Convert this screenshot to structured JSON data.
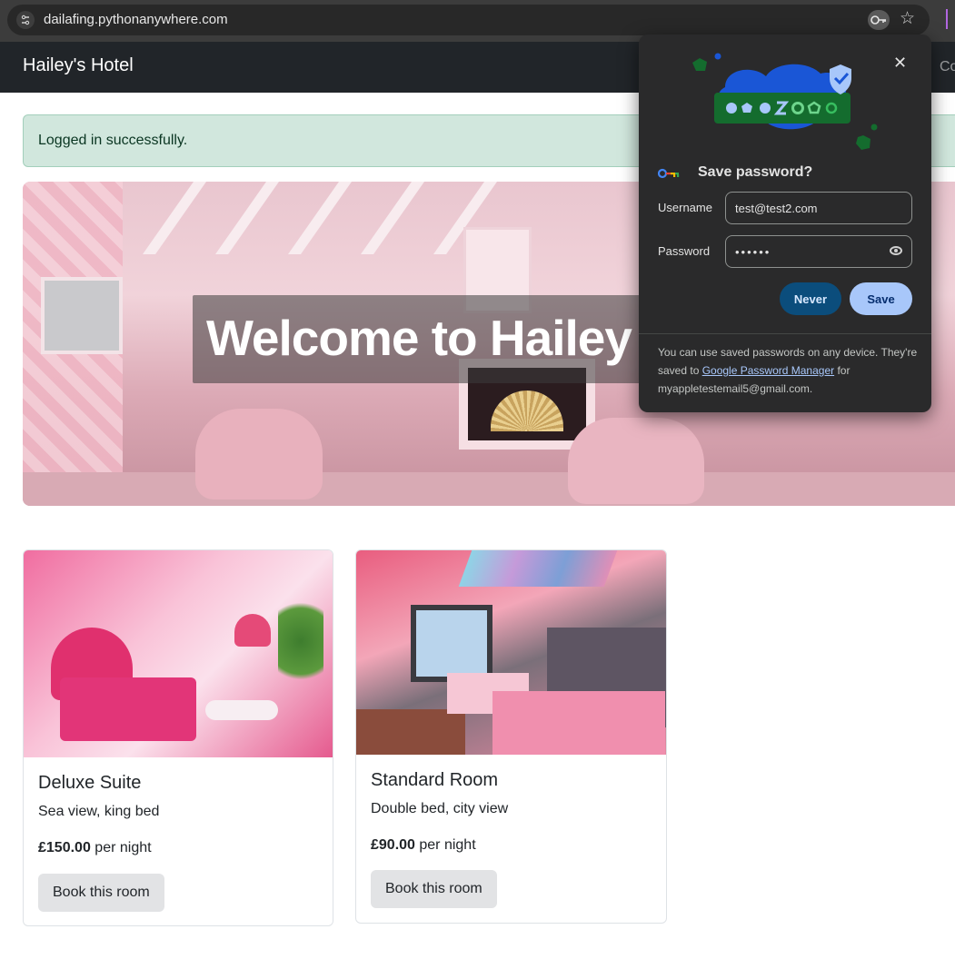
{
  "browser": {
    "url": "dailafing.pythonanywhere.com",
    "icons": [
      "site-settings-icon",
      "password-key-icon",
      "bookmark-star-icon"
    ]
  },
  "navbar": {
    "brand": "Hailey's Hotel",
    "link_partial": "Co"
  },
  "alert": {
    "message": "Logged in successfully."
  },
  "hero": {
    "title": "Welcome to Hailey"
  },
  "rooms": [
    {
      "name": "Deluxe Suite",
      "description": "Sea view, king bed",
      "price": "£150.00",
      "price_suffix": " per night",
      "button_label": "Book this room"
    },
    {
      "name": "Standard Room",
      "description": "Double bed, city view",
      "price": "£90.00",
      "price_suffix": " per night",
      "button_label": "Book this room"
    }
  ],
  "password_dialog": {
    "title": "Save password?",
    "username_label": "Username",
    "username_value": "test@test2.com",
    "password_label": "Password",
    "password_value": "••••••",
    "never_label": "Never",
    "save_label": "Save",
    "footer_text_1": "You can use saved passwords on any device. They're saved to ",
    "footer_link": "Google Password Manager",
    "footer_text_2": " for myappletestemail5@gmail.com.",
    "colors": {
      "never_bg": "#0b4d7c",
      "save_bg": "#a8c7fa",
      "illustration_blue": "#1a56d6",
      "illustration_green": "#146c2e"
    }
  },
  "colors": {
    "navbar_bg": "#212529",
    "alert_bg": "#d1e7dd",
    "button_bg": "#e2e3e5"
  }
}
